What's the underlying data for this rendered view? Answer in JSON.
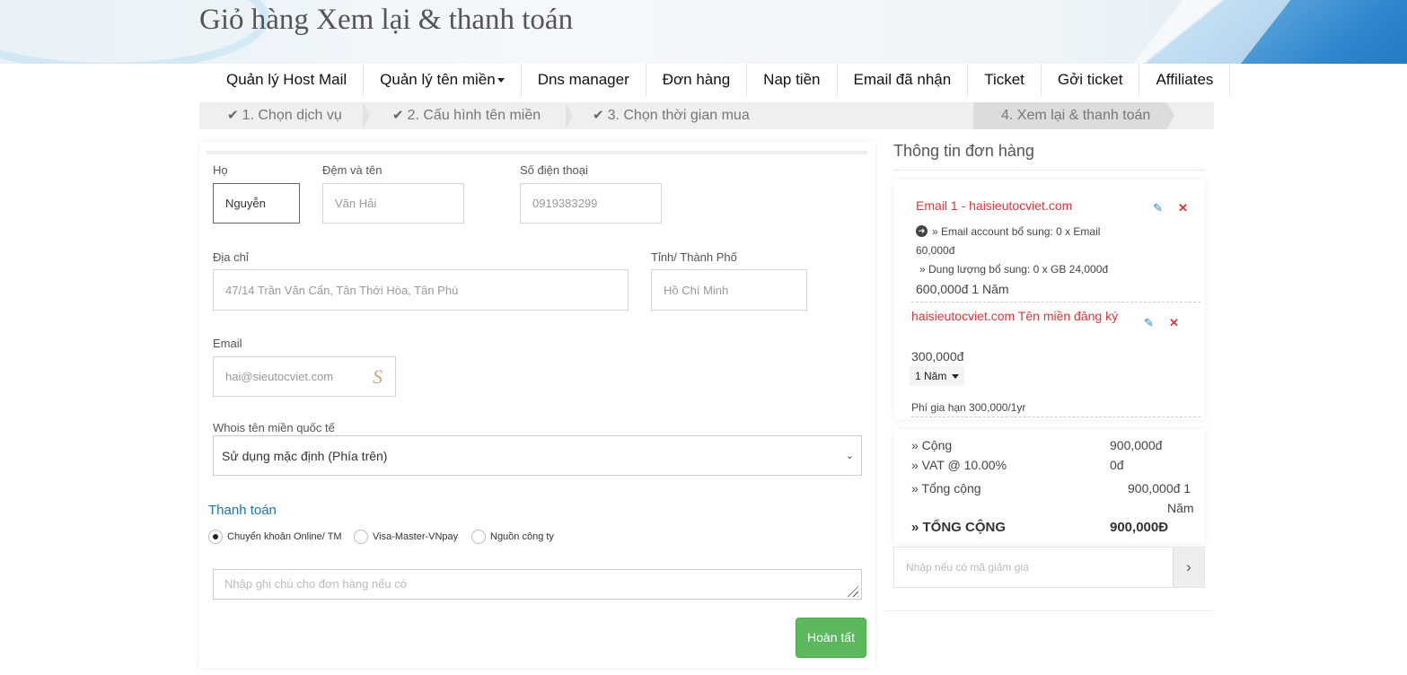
{
  "header": {
    "title": "Giỏ hàng Xem lại & thanh toán"
  },
  "nav": {
    "items": [
      "Quản lý Host Mail",
      "Quản lý tên miền",
      "Dns manager",
      "Đơn hàng",
      "Nap tiền",
      "Email đã nhận",
      "Ticket",
      "Gởi ticket",
      "Affiliates"
    ]
  },
  "steps": {
    "s1": "1. Chọn dịch vụ",
    "s2": "2. Cấu hình tên miền",
    "s3": "3. Chọn thời gian mua",
    "s4": "4. Xem lại & thanh toán"
  },
  "form": {
    "ho_label": "Họ",
    "ho_value": "Nguyễn",
    "ten_label": "Đệm và tên",
    "ten_value": "Văn Hải",
    "phone_label": "Số điện thoại",
    "phone_value": "0919383299",
    "address_label": "Địa chỉ",
    "address_value": "47/14 Trần Văn Cẩn, Tân Thới Hòa, Tân Phú",
    "city_label": "Tỉnh/ Thành Phố",
    "city_value": "Hồ Chí Minh",
    "email_label": "Email",
    "email_value": "hai@sieutocviet.com",
    "whois_label": "Whois tên miền quốc tế",
    "whois_value": "Sử dụng mặc định (Phía trên)",
    "payment_title": "Thanh toán",
    "payment_options": [
      "Chuyển khoản Online/ TM",
      "Visa-Master-VNpay",
      "Nguồn công ty"
    ],
    "note_placeholder": "Nhập ghi chú cho đơn hàng nếu có",
    "submit_label": "Hoàn tất"
  },
  "summary": {
    "title": "Thông tin đơn hàng",
    "item1": {
      "name": "Email 1 - haisieutocviet.com",
      "line1": "» Email account bổ sung: 0 x Email",
      "line1b": "60,000đ",
      "line2": "» Dung lượng bổ sung: 0 x GB 24,000đ",
      "price": "600,000đ 1 Năm"
    },
    "item2": {
      "name": "haisieutocviet.com Tên miền đăng ký",
      "price": "300,000đ",
      "period": "1 Năm",
      "renew": "Phí gia hạn 300,000/1yr"
    },
    "totals": {
      "subtotal_label": "» Cộng",
      "subtotal_value": "900,000đ",
      "vat_label": "» VAT @ 10.00%",
      "vat_value": "0đ",
      "total_label": "» Tổng cộng",
      "total_value": "900,000đ 1",
      "total_value_2": "Năm",
      "grand_label": "» TỔNG CỘNG",
      "grand_value": "900,000Đ"
    },
    "promo_placeholder": "Nhập nếu có mã giảm giá"
  }
}
